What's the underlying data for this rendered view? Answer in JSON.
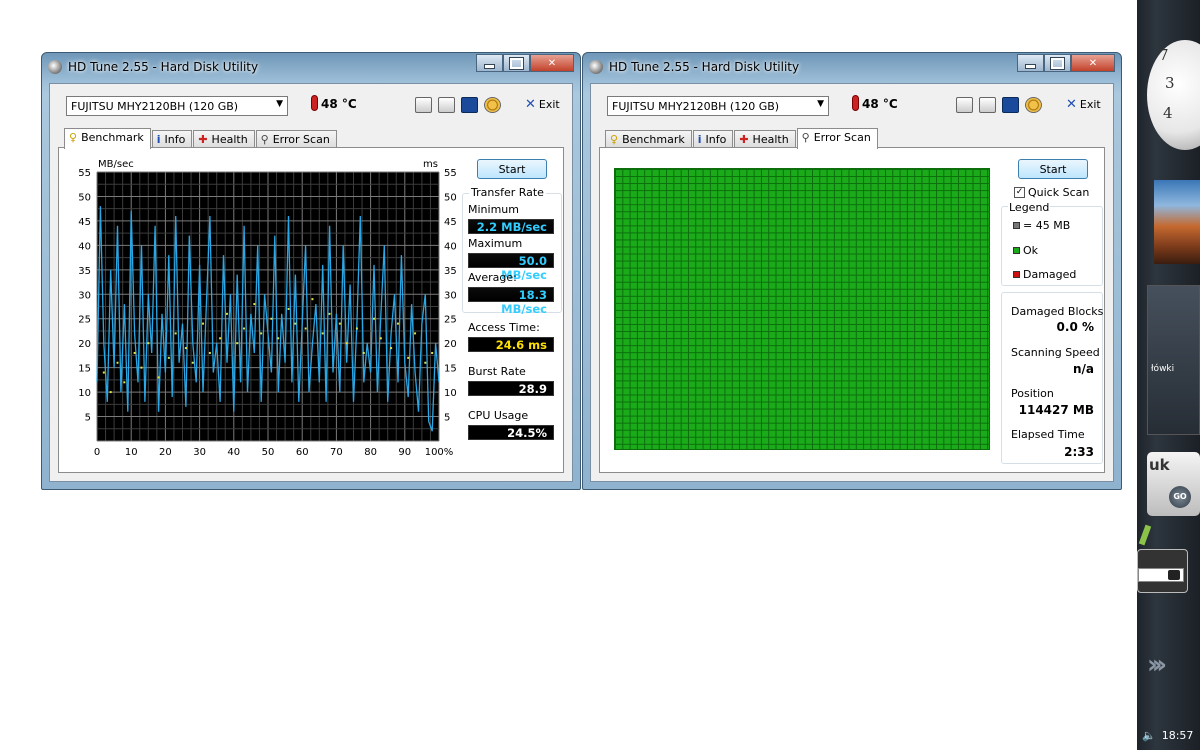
{
  "app": {
    "title": "HD Tune 2.55 - Hard Disk Utility",
    "drive": "FUJITSU MHY2120BH (120 GB)",
    "temperature": "48 °C",
    "exit_label": "Exit"
  },
  "tabs": [
    {
      "label": "Benchmark",
      "icon": "benchmark-icon"
    },
    {
      "label": "Info",
      "icon": "info-icon"
    },
    {
      "label": "Health",
      "icon": "health-icon"
    },
    {
      "label": "Error Scan",
      "icon": "error-scan-icon"
    }
  ],
  "benchmark": {
    "start_label": "Start",
    "transfer_rate_label": "Transfer Rate",
    "minimum_label": "Minimum",
    "minimum": "2.2 MB/sec",
    "maximum_label": "Maximum",
    "maximum": "50.0 MB/sec",
    "average_label": "Average:",
    "average": "18.3 MB/sec",
    "access_time_label": "Access Time:",
    "access_time": "24.6 ms",
    "burst_rate_label": "Burst Rate",
    "burst_rate": "28.9 MB/sec",
    "cpu_usage_label": "CPU Usage",
    "cpu_usage": "24.5%"
  },
  "chart_data": {
    "type": "line",
    "y_left_label": "MB/sec",
    "y_right_label": "ms",
    "ylim": [
      0,
      55
    ],
    "yticks_left": [
      "55",
      "50",
      "45",
      "40",
      "35",
      "30",
      "25",
      "20",
      "15",
      "10",
      "5"
    ],
    "yticks_right": [
      "55",
      "50",
      "45",
      "40",
      "35",
      "30",
      "25",
      "20",
      "15",
      "10",
      "5"
    ],
    "xticks": [
      "0",
      "10",
      "20",
      "30",
      "40",
      "50",
      "60",
      "70",
      "80",
      "90",
      "100%"
    ],
    "xlim": [
      0,
      100
    ],
    "grid": true,
    "series": [
      {
        "color": "#2aa7e6",
        "x": [
          0,
          1,
          2,
          3,
          4,
          5,
          6,
          7,
          8,
          9,
          10,
          11,
          12,
          13,
          14,
          15,
          16,
          17,
          18,
          19,
          20,
          21,
          22,
          23,
          24,
          25,
          26,
          27,
          28,
          29,
          30,
          31,
          32,
          33,
          34,
          35,
          36,
          37,
          38,
          39,
          40,
          41,
          42,
          43,
          44,
          45,
          46,
          47,
          48,
          49,
          50,
          51,
          52,
          53,
          54,
          55,
          56,
          57,
          58,
          59,
          60,
          61,
          62,
          63,
          64,
          65,
          66,
          67,
          68,
          69,
          70,
          71,
          72,
          73,
          74,
          75,
          76,
          77,
          78,
          79,
          80,
          81,
          82,
          83,
          84,
          85,
          86,
          87,
          88,
          89,
          90,
          91,
          92,
          93,
          94,
          95,
          96,
          97,
          98,
          99,
          100
        ],
        "y": [
          12,
          48,
          20,
          8,
          35,
          15,
          44,
          10,
          28,
          6,
          47,
          22,
          12,
          40,
          8,
          30,
          18,
          44,
          6,
          26,
          14,
          38,
          9,
          46,
          16,
          24,
          7,
          42,
          20,
          12,
          36,
          10,
          28,
          46,
          14,
          20,
          8,
          38,
          16,
          30,
          6,
          34,
          12,
          44,
          10,
          26,
          18,
          40,
          8,
          30,
          22,
          14,
          42,
          10,
          26,
          16,
          46,
          12,
          34,
          8,
          24,
          40,
          10,
          20,
          28,
          12,
          36,
          8,
          44,
          14,
          26,
          10,
          40,
          16,
          32,
          8,
          24,
          46,
          12,
          20,
          14,
          36,
          10,
          26,
          40,
          8,
          22,
          30,
          12,
          38,
          16,
          9,
          28,
          14,
          6,
          24,
          30,
          4,
          2,
          20,
          12
        ]
      },
      {
        "color": "#e5e24a",
        "points": "dots",
        "x": [
          2,
          4,
          6,
          8,
          11,
          13,
          15,
          18,
          21,
          23,
          26,
          28,
          31,
          33,
          36,
          38,
          41,
          43,
          46,
          48,
          51,
          53,
          56,
          58,
          61,
          63,
          66,
          68,
          71,
          73,
          76,
          78,
          81,
          83,
          86,
          88,
          91,
          93,
          96,
          98
        ],
        "y": [
          14,
          10,
          16,
          12,
          18,
          15,
          20,
          13,
          17,
          22,
          19,
          16,
          24,
          18,
          21,
          26,
          20,
          23,
          28,
          22,
          25,
          21,
          27,
          24,
          23,
          29,
          22,
          26,
          24,
          20,
          23,
          18,
          25,
          21,
          19,
          24,
          17,
          22,
          16,
          18
        ]
      }
    ]
  },
  "error_scan": {
    "start_label": "Start",
    "quick_scan_label": "Quick Scan",
    "legend_label": "Legend",
    "legend_block": "= 45 MB",
    "legend_ok": "Ok",
    "legend_damaged": "Damaged",
    "damaged_blocks_label": "Damaged Blocks",
    "damaged_blocks": "0.0 %",
    "scanning_speed_label": "Scanning Speed",
    "scanning_speed": "n/a",
    "position_label": "Position",
    "position": "114427 MB",
    "elapsed_label": "Elapsed Time",
    "elapsed": "2:33",
    "ok_color": "#1aaa1a",
    "damaged_color": "#cc1111"
  },
  "sidebar": {
    "clock_3": "3",
    "clock_4": "4",
    "clock_7": "7",
    "widget_text": "łówki",
    "dict_text": "uk",
    "go_label": "GO",
    "time": "18:57"
  }
}
